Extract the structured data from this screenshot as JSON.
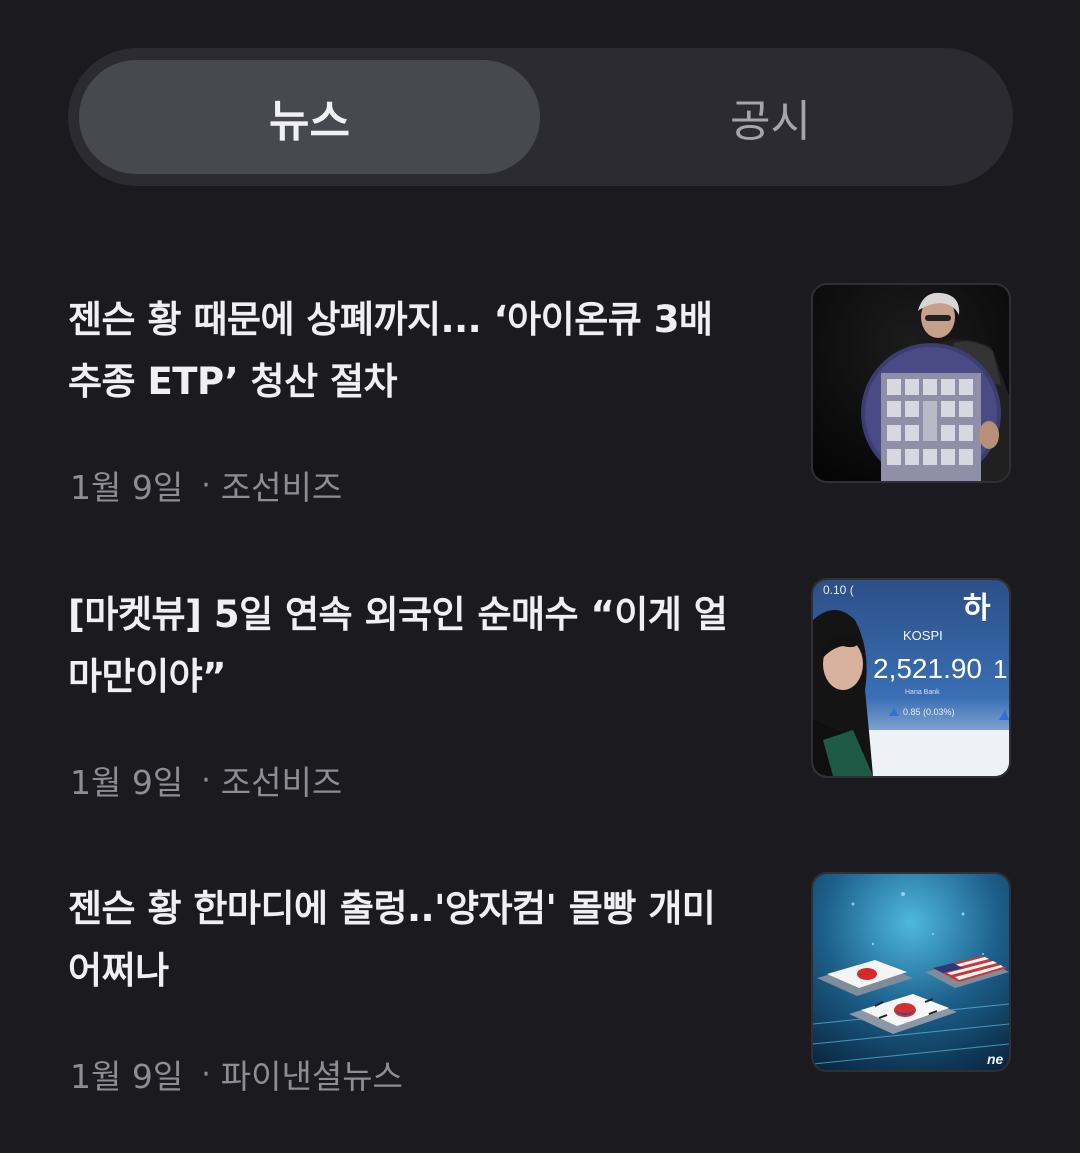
{
  "tabs": {
    "news_label": "뉴스",
    "disclosure_label": "공시",
    "active": "news"
  },
  "news": [
    {
      "title": "젠슨 황 때문에 상폐까지... ‘아이온큐 3배 추종 ETP’ 청산 절차",
      "date": "1월 9일",
      "source": "조선비즈",
      "thumb_icon": "chip-wafer-presenter-image"
    },
    {
      "title": "[마켓뷰] 5일 연속 외국인 순매수 “이게 얼마만이야”",
      "date": "1월 9일",
      "source": "조선비즈",
      "thumb_icon": "kospi-board-image",
      "thumb_text": {
        "corner": "0.10 (",
        "logo": "하",
        "index_label": "KOSPI",
        "index_value": "2,521.90",
        "partial_value": "1,",
        "bank": "Hana Bank",
        "change": "0.85 (0.03%)"
      }
    },
    {
      "title": "젠슨 황 한마디에 출렁..'양자컴' 몰빵 개미 어쩌나",
      "date": "1월 9일",
      "source": "파이낸셜뉴스",
      "thumb_icon": "flag-chips-image",
      "thumb_text": {
        "watermark": "ne"
      }
    }
  ],
  "colors": {
    "background": "#1b1b1f",
    "segment_bg": "#2b2b31",
    "segment_active": "#484851",
    "headline": "#f0f0f4",
    "meta": "#8d8d95",
    "kospi_up": "#2f6fd6"
  }
}
